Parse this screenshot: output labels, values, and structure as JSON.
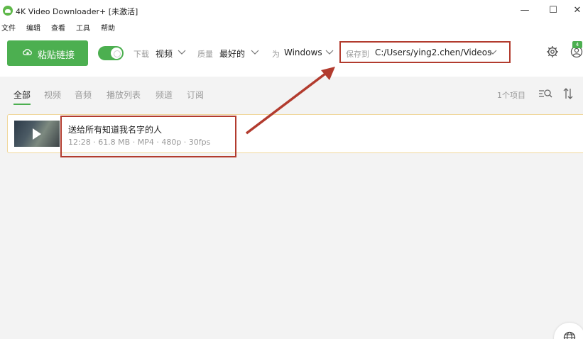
{
  "window": {
    "title": "4K Video Downloader+ [未激活]",
    "minimize": "—",
    "maximize": "☐",
    "close": "✕"
  },
  "menu": [
    "文件",
    "编辑",
    "查看",
    "工具",
    "帮助"
  ],
  "toolbar": {
    "paste_label": "粘贴链接",
    "smart_mode_on": true,
    "download_label": "下载",
    "download_value": "视频",
    "quality_label": "质量",
    "quality_value": "最好的",
    "for_label": "为",
    "for_value": "Windows",
    "save_label": "保存到",
    "save_value": "C:/Users/ying2.chen/Videos",
    "account_badge": "4"
  },
  "tabs": [
    "全部",
    "视频",
    "音频",
    "播放列表",
    "频道",
    "订阅"
  ],
  "active_tab": "全部",
  "item_count": "1个项目",
  "items": [
    {
      "title": "送给所有知道我名字的人",
      "meta": "12:28 · 61.8 MB · MP4 · 480p · 30fps"
    }
  ],
  "colors": {
    "accent": "#4caf50",
    "annotation": "#b23b2e",
    "highlight_border": "#f0d79a"
  },
  "icons": [
    "app-logo-icon",
    "link-icon",
    "chevron-down-icon",
    "gear-icon",
    "account-icon",
    "search-icon",
    "sort-icon",
    "play-icon",
    "globe-icon"
  ]
}
